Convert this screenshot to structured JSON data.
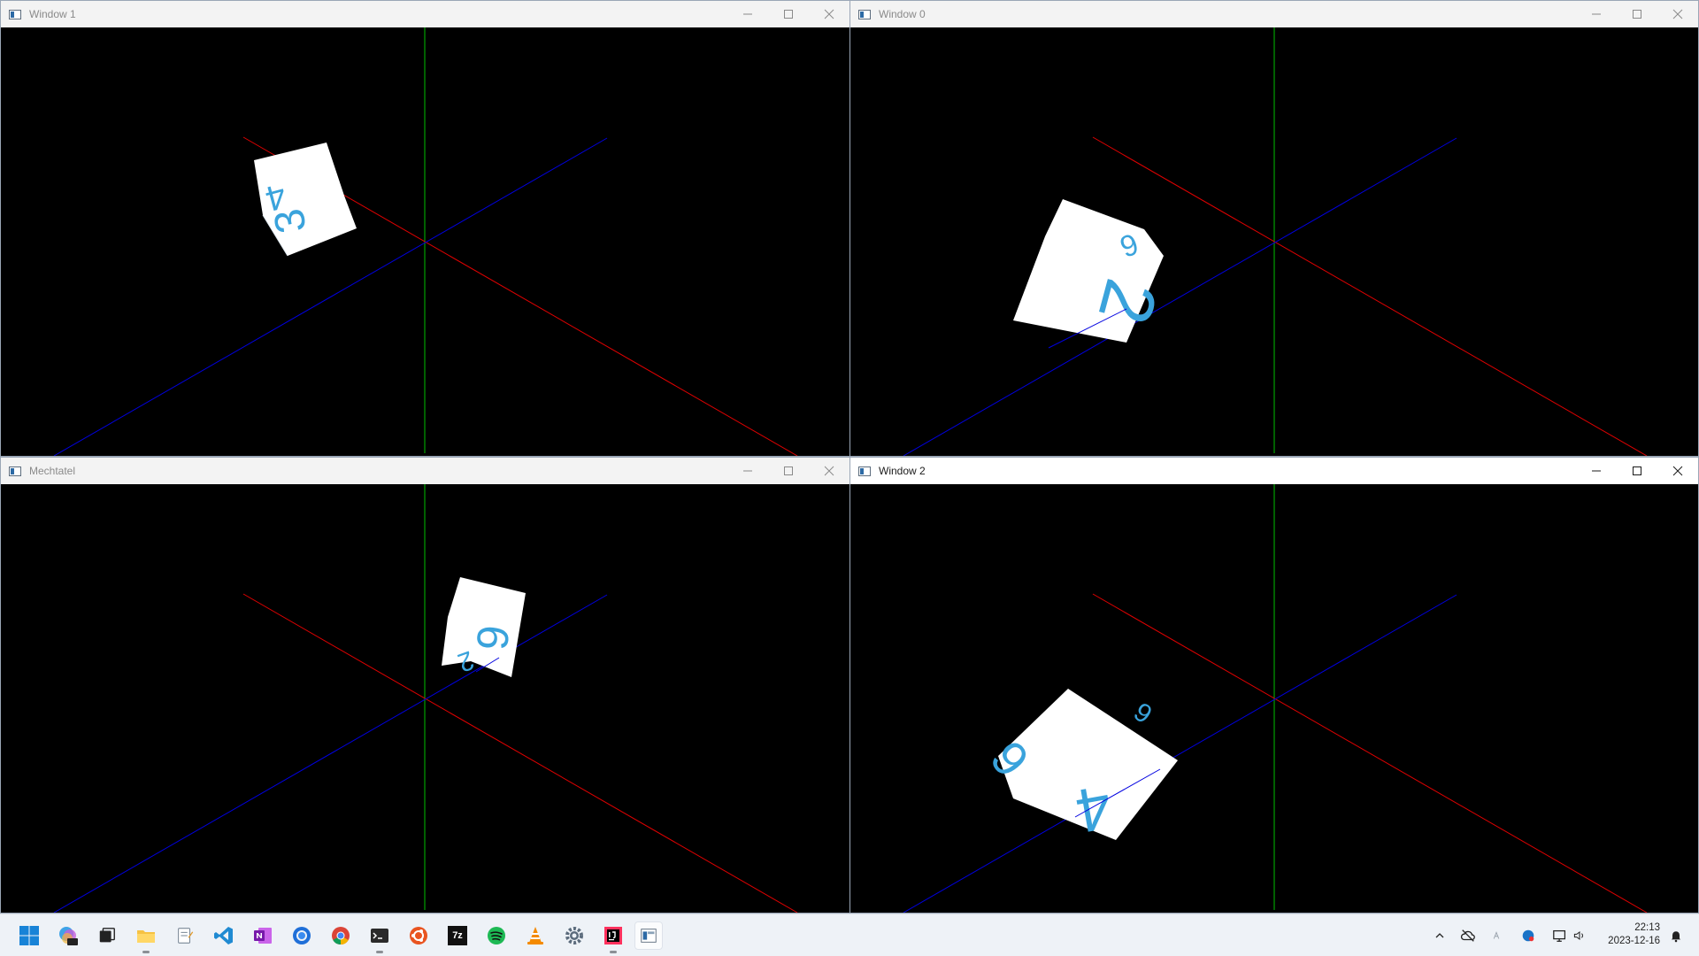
{
  "windows": [
    {
      "title": "Window 1",
      "state": "inactive",
      "face_labels": [
        "4",
        "3"
      ]
    },
    {
      "title": "Window 0",
      "state": "inactive",
      "face_labels": [
        "6",
        "2"
      ]
    },
    {
      "title": "Mechtatel",
      "state": "inactive",
      "face_labels": [
        "6",
        "2"
      ]
    },
    {
      "title": "Window 2",
      "state": "active",
      "face_labels": [
        "9",
        "6",
        "4"
      ]
    }
  ],
  "caption_icons": [
    "minimize-icon",
    "maximize-icon",
    "close-icon"
  ],
  "axis_colors": {
    "x": "#e00000",
    "y": "#00c000",
    "z": "#0000e0"
  },
  "cube": {
    "face_color": "#ffffff",
    "digit_color": "#3aa3dc"
  },
  "taskbar": {
    "apps": [
      "windows-start-icon",
      "copilot-pre-icon",
      "task-view-icon",
      "file-explorer-icon",
      "notepad-icon",
      "vscode-icon",
      "onenote-icon",
      "firefox-icon",
      "chrome-icon",
      "terminal-icon",
      "ubuntu-icon",
      "7zip-icon",
      "spotify-icon",
      "vlc-icon",
      "settings-icon",
      "intellij-icon",
      "java-app-icon"
    ],
    "tray": [
      "chevron-up-icon",
      "cloud-offline-icon",
      "ime-icon",
      "bluetooth-app-icon",
      "network-icon",
      "volume-icon",
      "notifications-icon"
    ],
    "time": "22:13",
    "date": "2023-12-16",
    "labels": {
      "seven_zip": "7z"
    }
  }
}
